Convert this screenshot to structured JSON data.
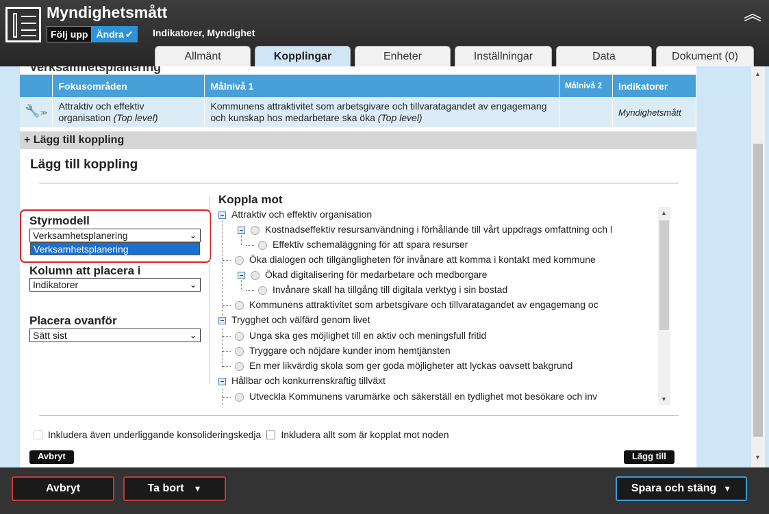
{
  "header": {
    "title": "Myndighetsmått",
    "mode_follow": "Följ upp",
    "mode_edit": "Ändra",
    "breadcrumb": "Indikatorer, Myndighet"
  },
  "tabs": [
    "Allmänt",
    "Kopplingar",
    "Enheter",
    "Inställningar",
    "Data",
    "Dokument (0)"
  ],
  "active_tab": "Kopplingar",
  "section_title": "Verksamhetsplanering",
  "table": {
    "headers": [
      "Fokusområden",
      "Målnivå 1",
      "Målnivå 2",
      "Indikatorer"
    ],
    "rows": [
      {
        "fokus": "Attraktiv och effektiv organisation",
        "fokus_tag": "(Top level)",
        "malniva1": "Kommunens attraktivitet som arbetsgivare och tillvaratagandet av engagemang och kunskap hos medarbetare ska öka",
        "malniva1_tag": "(Top level)",
        "malniva2": "",
        "indikator": "Myndighetsmått"
      }
    ]
  },
  "add_bar": "+ Lägg till koppling",
  "dialog": {
    "title": "Lägg till koppling",
    "styrmodell_label": "Styrmodell",
    "styrmodell_value": "Verksamhetsplanering",
    "styrmodell_options": [
      "Verksamhetsplanering"
    ],
    "kolumn_label": "Kolumn att placera i",
    "kolumn_value": "Indikatorer",
    "placera_label": "Placera ovanför",
    "placera_value": "Sätt sist",
    "koppla_title": "Koppla mot",
    "tree": [
      "Attraktiv och effektiv organisation",
      "Kostnadseffektiv resursanvändning i förhållande till vårt uppdrags omfattning och l",
      "Effektiv schemaläggning för att spara resurser",
      "Öka dialogen och tillgängligheten för invånare att komma i kontakt med kommune",
      "Ökad digitalisering för medarbetare och medborgare",
      "Invånare skall ha tillgång till digitala verktyg i sin bostad",
      "Kommunens attraktivitet som arbetsgivare och tillvaratagandet av engagemang oc",
      "Trygghet och välfärd genom livet",
      "Unga ska ges möjlighet till en aktiv och meningsfull fritid",
      "Tryggare och nöjdare kunder inom hemtjänsten",
      "En mer likvärdig skola som ger goda möjligheter att lyckas oavsett bakgrund",
      "Hållbar och konkurrenskraftig tillväxt",
      "Utveckla Kommunens varumärke och säkerställ en tydlighet mot besökare och inv"
    ],
    "checkbox1": "Inkludera även underliggande konsolideringskedja",
    "checkbox2": "Inkludera allt som är kopplat mot noden",
    "cancel": "Avbryt",
    "add": "Lägg till"
  },
  "footer": {
    "cancel": "Avbryt",
    "delete": "Ta bort",
    "save_close": "Spara och stäng"
  },
  "colors": {
    "header_bg": "#2b2b2b",
    "accent": "#47a0d8",
    "active_mode": "#2e92d4",
    "page_bg": "#cfe6f6",
    "highlight": "#e02020"
  }
}
